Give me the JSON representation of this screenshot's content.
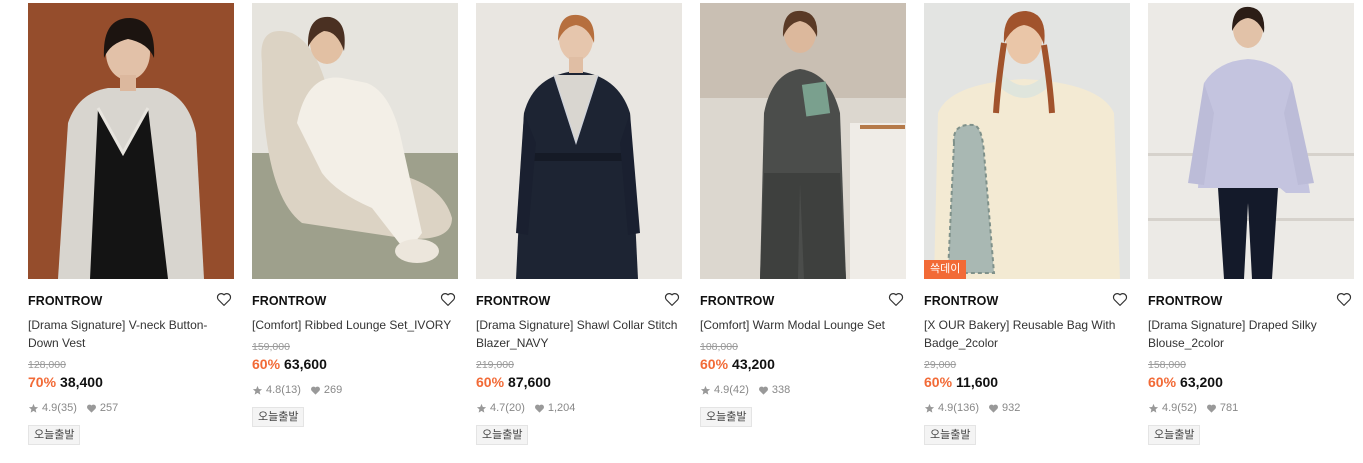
{
  "products": [
    {
      "brand": "FRONTROW",
      "name": "[Drama Signature] V-neck Button-Down Vest",
      "original_price": "128,000",
      "discount": "70%",
      "sale_price": "38,400",
      "rating": "4.9",
      "review_count": "(35)",
      "likes": "257",
      "tag": "오늘출발",
      "badge": ""
    },
    {
      "brand": "FRONTROW",
      "name": "[Comfort] Ribbed Lounge Set_IVORY",
      "original_price": "159,000",
      "discount": "60%",
      "sale_price": "63,600",
      "rating": "4.8",
      "review_count": "(13)",
      "likes": "269",
      "tag": "오늘출발",
      "badge": ""
    },
    {
      "brand": "FRONTROW",
      "name": "[Drama Signature] Shawl Collar Stitch Blazer_NAVY",
      "original_price": "219,000",
      "discount": "60%",
      "sale_price": "87,600",
      "rating": "4.7",
      "review_count": "(20)",
      "likes": "1,204",
      "tag": "오늘출발",
      "badge": ""
    },
    {
      "brand": "FRONTROW",
      "name": "[Comfort] Warm Modal Lounge Set",
      "original_price": "108,000",
      "discount": "60%",
      "sale_price": "43,200",
      "rating": "4.9",
      "review_count": "(42)",
      "likes": "338",
      "tag": "오늘출발",
      "badge": ""
    },
    {
      "brand": "FRONTROW",
      "name": "[X OUR Bakery] Reusable Bag With Badge_2color",
      "original_price": "29,000",
      "discount": "60%",
      "sale_price": "11,600",
      "rating": "4.9",
      "review_count": "(136)",
      "likes": "932",
      "tag": "오늘출발",
      "badge": "쓱데이"
    },
    {
      "brand": "FRONTROW",
      "name": "[Drama Signature] Draped Silky Blouse_2color",
      "original_price": "158,000",
      "discount": "60%",
      "sale_price": "63,200",
      "rating": "4.9",
      "review_count": "(52)",
      "likes": "781",
      "tag": "오늘출발",
      "badge": ""
    }
  ],
  "icons": {
    "wishlist": "heart-outline-icon",
    "rating": "star-icon",
    "likes": "heart-filled-icon"
  },
  "colors": {
    "discount": "#f26a36",
    "badge_bg": "#f26a36",
    "muted": "#888888"
  }
}
